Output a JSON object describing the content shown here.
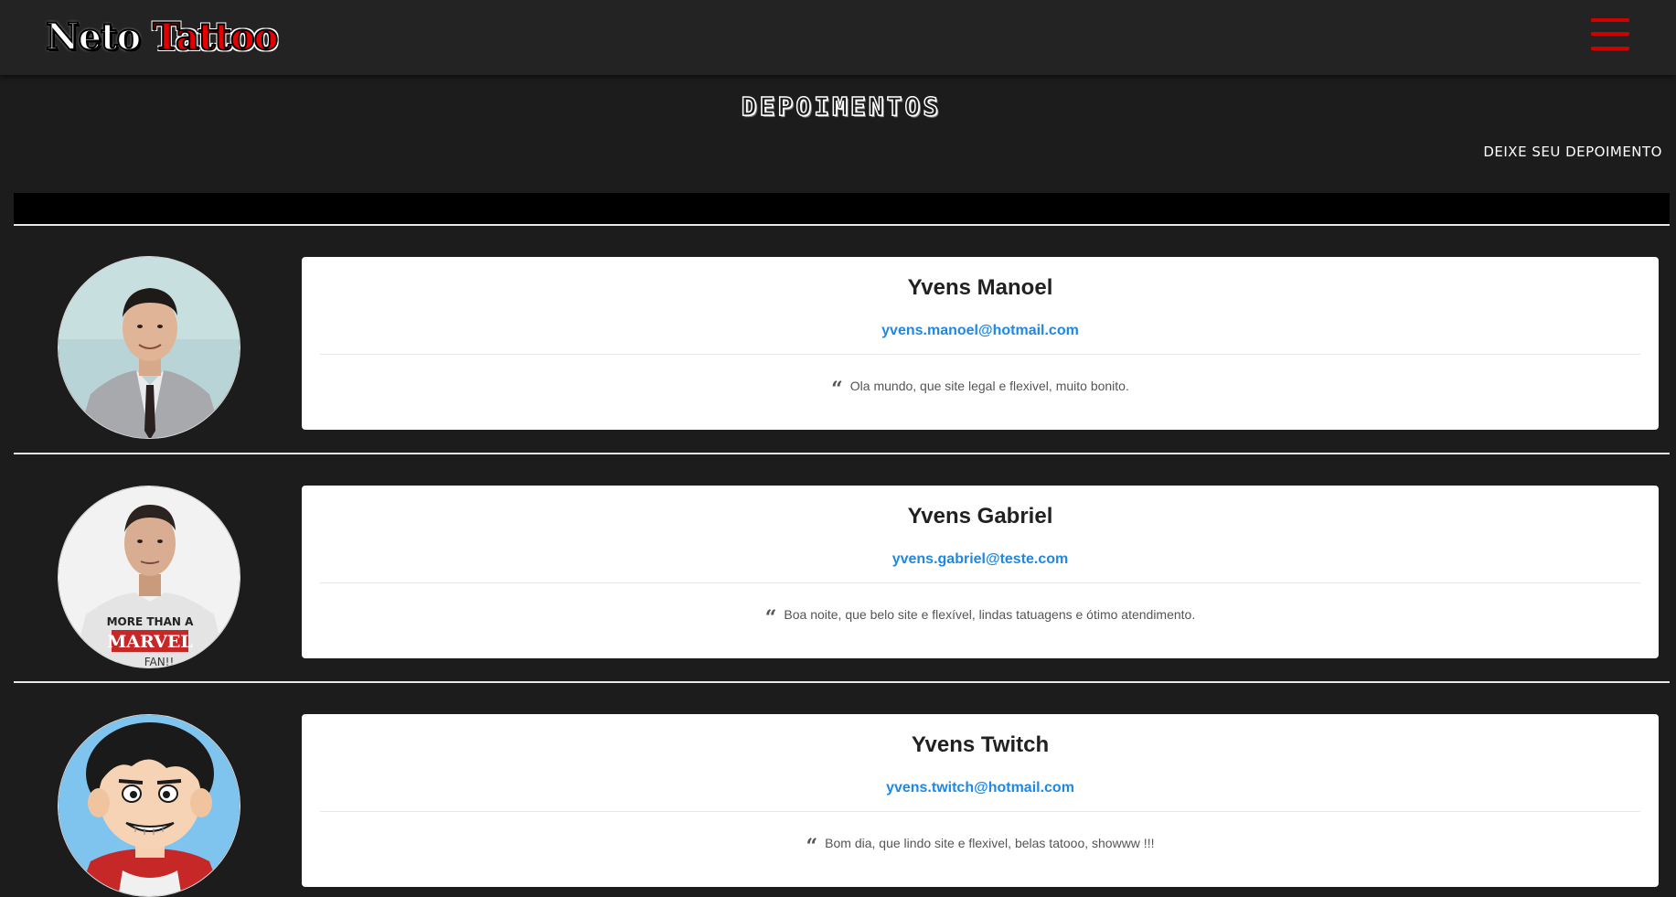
{
  "header": {
    "logo_first": "Neto",
    "logo_second": "Tattoo",
    "menu_icon": "hamburger-menu-icon",
    "accent_color": "#d00000"
  },
  "page": {
    "title": "DEPOIMENTOS",
    "leave_testimonial": "DEIXE SEU DEPOIMENTO"
  },
  "testimonials": [
    {
      "name": "Yvens Manoel",
      "email": "yvens.manoel@hotmail.com",
      "quote": "Ola mundo, que site legal e flexivel, muito bonito.",
      "avatar": "man-in-suit-photo"
    },
    {
      "name": "Yvens Gabriel",
      "email": "yvens.gabriel@teste.com",
      "quote": "Boa noite, que belo site e flexível, lindas tatuagens e ótimo atendimento.",
      "avatar": "man-in-marvel-tshirt-photo",
      "shirt_text_1": "MORE THAN A",
      "shirt_text_2": "MARVEL",
      "shirt_text_3": "FAN!!"
    },
    {
      "name": "Yvens Twitch",
      "email": "yvens.twitch@hotmail.com",
      "quote": "Bom dia, que lindo site e flexivel, belas tatooo, showww !!!",
      "avatar": "cartoon-avatar"
    }
  ],
  "quote_icon": "quote-left-icon",
  "email_color": "#1e88e5"
}
